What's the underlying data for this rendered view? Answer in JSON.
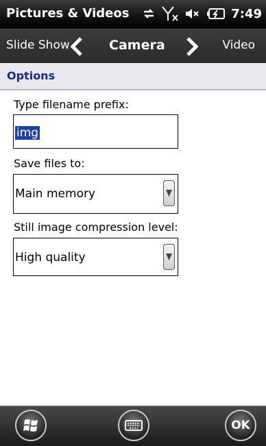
{
  "app": {
    "title": "Pictures & Videos",
    "clock": "7:49"
  },
  "nav": {
    "prev": "Slide Show",
    "current": "Camera",
    "next": "Video"
  },
  "section": {
    "title": "Options"
  },
  "form": {
    "prefix_label": "Type filename prefix:",
    "prefix_value": "img",
    "save_label": "Save files to:",
    "save_value": "Main memory",
    "compression_label": "Still image compression level:",
    "compression_value": "High quality"
  },
  "buttons": {
    "ok": "OK"
  },
  "icons": [
    "sync-icon",
    "signal-off-icon",
    "volume-muted-icon",
    "battery-charging-icon",
    "chevron-left-icon",
    "chevron-right-icon",
    "windows-start-icon",
    "keyboard-icon",
    "dropdown-arrow-icon"
  ],
  "colors": {
    "accent": "#1a2a8c",
    "selection": "#1f3fa5"
  }
}
